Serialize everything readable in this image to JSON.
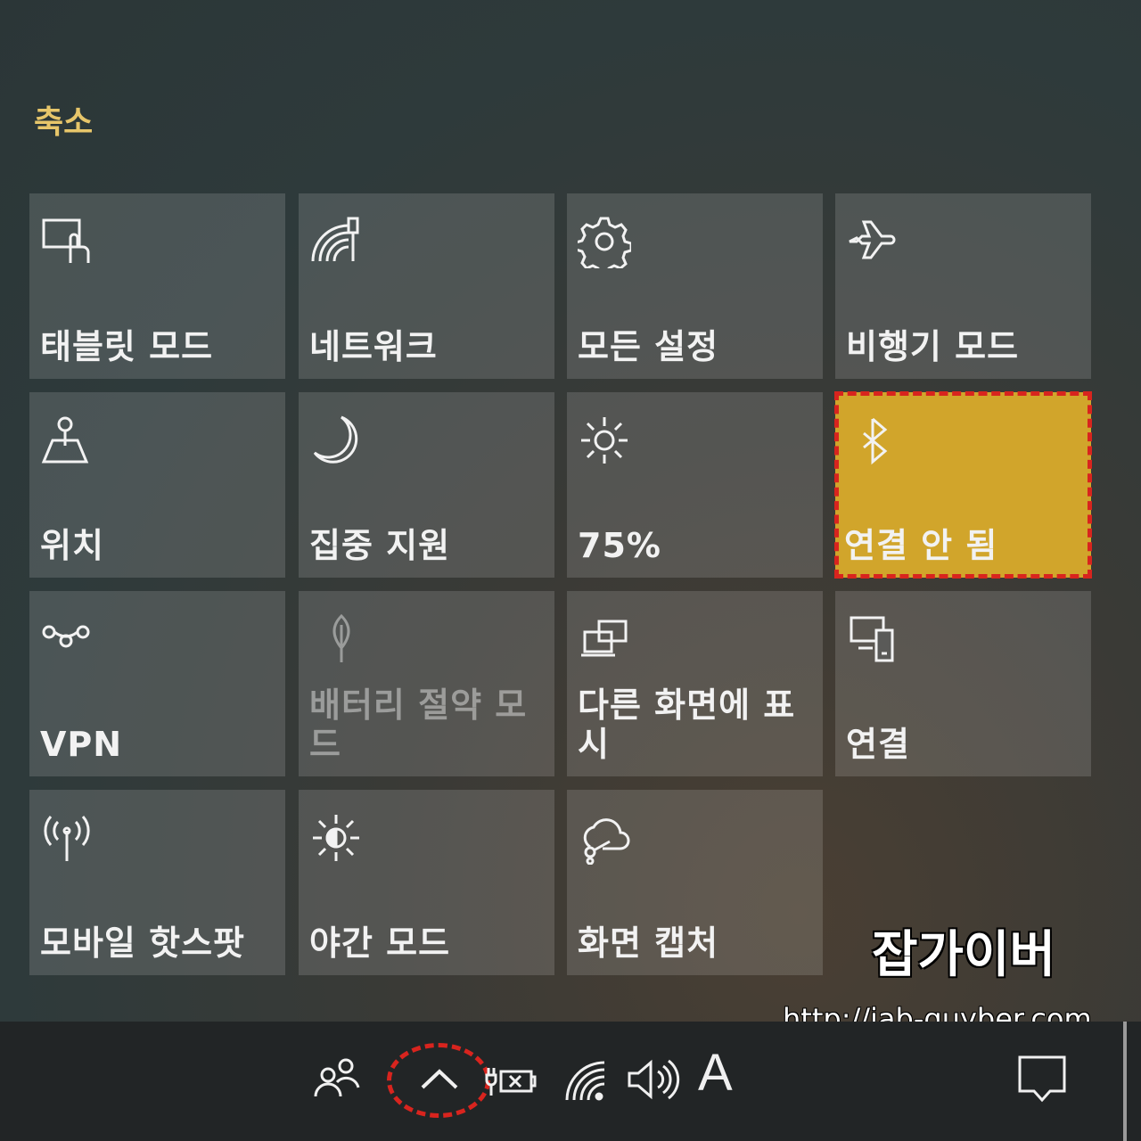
{
  "header": {
    "collapse_label": "축소"
  },
  "tiles": [
    {
      "label": "태블릿 모드",
      "icon": "tablet-mode-icon",
      "state": "off"
    },
    {
      "label": "네트워크",
      "icon": "network-icon",
      "state": "off"
    },
    {
      "label": "모든 설정",
      "icon": "gear-icon",
      "state": "off"
    },
    {
      "label": "비행기 모드",
      "icon": "airplane-icon",
      "state": "off"
    },
    {
      "label": "위치",
      "icon": "location-icon",
      "state": "off"
    },
    {
      "label": "집중 지원",
      "icon": "moon-icon",
      "state": "off"
    },
    {
      "label": "75%",
      "icon": "brightness-icon",
      "state": "off"
    },
    {
      "label": "연결 안 됨",
      "icon": "bluetooth-icon",
      "state": "on"
    },
    {
      "label": "VPN",
      "icon": "vpn-icon",
      "state": "off"
    },
    {
      "label": "배터리 절약 모드",
      "icon": "leaf-icon",
      "state": "disabled"
    },
    {
      "label": "다른 화면에 표시",
      "icon": "project-icon",
      "state": "off"
    },
    {
      "label": "연결",
      "icon": "connect-icon",
      "state": "off"
    },
    {
      "label": "모바일 핫스팟",
      "icon": "hotspot-icon",
      "state": "off"
    },
    {
      "label": "야간 모드",
      "icon": "night-light-icon",
      "state": "off"
    },
    {
      "label": "화면 캡처",
      "icon": "snip-icon",
      "state": "off"
    }
  ],
  "taskbar": {
    "input_indicator": "A",
    "icons": [
      "people-icon",
      "chevron-up-icon",
      "battery-icon",
      "wifi-icon",
      "volume-icon",
      "action-center-icon"
    ]
  },
  "watermark": {
    "title": "잡가이버",
    "url": "http://jab-guyber.com"
  },
  "colors": {
    "accent": "#d1a52b",
    "highlight": "#d8241e",
    "collapse_text": "#e7c66a"
  }
}
